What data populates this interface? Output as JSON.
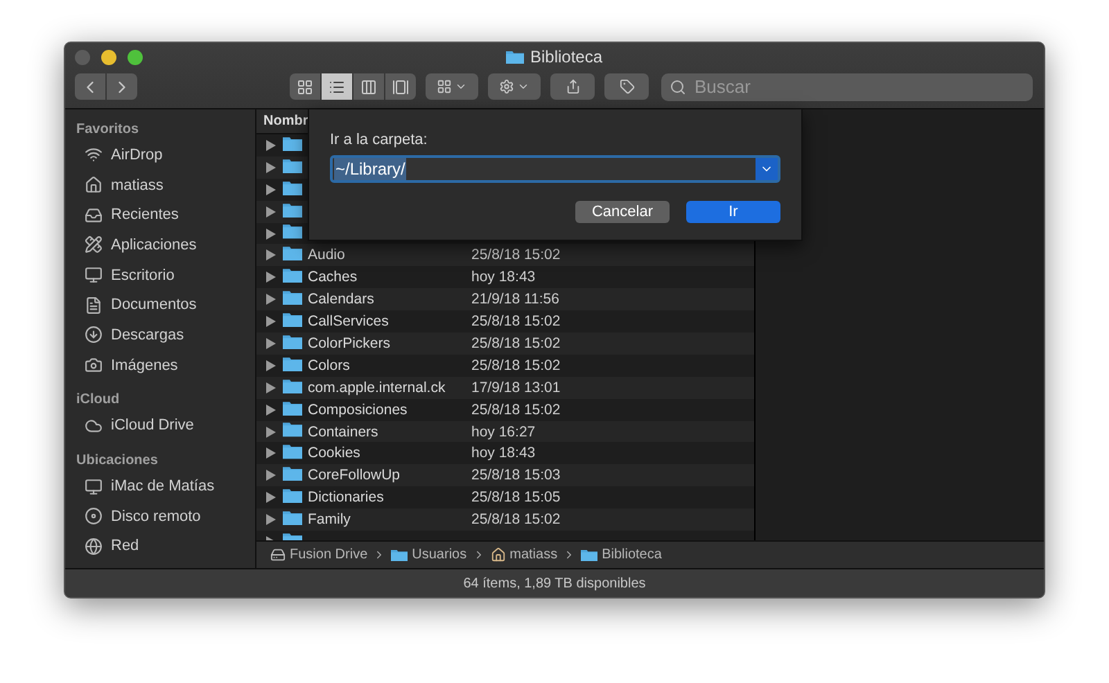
{
  "window": {
    "title": "Biblioteca"
  },
  "toolbar": {
    "views": [
      {
        "selected": false
      },
      {
        "selected": true
      },
      {
        "selected": false
      },
      {
        "selected": false
      }
    ],
    "search": {
      "placeholder": "Buscar"
    }
  },
  "sidebar": [
    {
      "heading": "Favoritos",
      "items": [
        "AirDrop",
        "matiass",
        "Recientes",
        "Aplicaciones",
        "Escritorio",
        "Documentos",
        "Descargas",
        "Imágenes"
      ]
    },
    {
      "heading": "iCloud",
      "items": [
        "iCloud Drive"
      ]
    },
    {
      "heading": "Ubicaciones",
      "items": [
        "iMac de Matías",
        "Disco remoto",
        "Red"
      ]
    }
  ],
  "list": {
    "columns": [
      "Nombr"
    ],
    "rows": [
      {
        "kind": "covered"
      },
      {
        "kind": "covered"
      },
      {
        "kind": "covered"
      },
      {
        "kind": "covered"
      },
      {
        "kind": "covered"
      },
      {
        "kind": "folder",
        "name": "Audio",
        "date": "25/8/18 15:02"
      },
      {
        "kind": "folder",
        "name": "Caches",
        "date": "hoy 18:43"
      },
      {
        "kind": "folder",
        "name": "Calendars",
        "date": "21/9/18 11:56"
      },
      {
        "kind": "folder",
        "name": "CallServices",
        "date": "25/8/18 15:02"
      },
      {
        "kind": "folder",
        "name": "ColorPickers",
        "date": "25/8/18 15:02"
      },
      {
        "kind": "folder",
        "name": "Colors",
        "date": "25/8/18 15:02"
      },
      {
        "kind": "folder",
        "name": "com.apple.internal.ck",
        "date": "17/9/18 13:01"
      },
      {
        "kind": "folder",
        "name": "Composiciones",
        "date": "25/8/18 15:02"
      },
      {
        "kind": "folder",
        "name": "Containers",
        "date": "hoy 16:27"
      },
      {
        "kind": "folder",
        "name": "Cookies",
        "date": "hoy 18:43"
      },
      {
        "kind": "folder",
        "name": "CoreFollowUp",
        "date": "25/8/18 15:03"
      },
      {
        "kind": "folder",
        "name": "Dictionaries",
        "date": "25/8/18 15:05"
      },
      {
        "kind": "folder",
        "name": "Family",
        "date": "25/8/18 15:02"
      },
      {
        "kind": "cut"
      }
    ]
  },
  "dialog": {
    "label": "Ir a la carpeta:",
    "value": "~/Library/",
    "buttons": [
      {
        "label": "Cancelar",
        "default": false
      },
      {
        "label": "Ir",
        "default": true
      }
    ]
  },
  "path_bar": [
    {
      "kind": "disk",
      "label": "Fusion Drive"
    },
    {
      "kind": "users",
      "label": "Usuarios"
    },
    {
      "kind": "home",
      "label": "matiass"
    },
    {
      "kind": "folder",
      "label": "Biblioteca"
    }
  ],
  "status_bar": "64 ítems, 1,89 TB disponibles"
}
